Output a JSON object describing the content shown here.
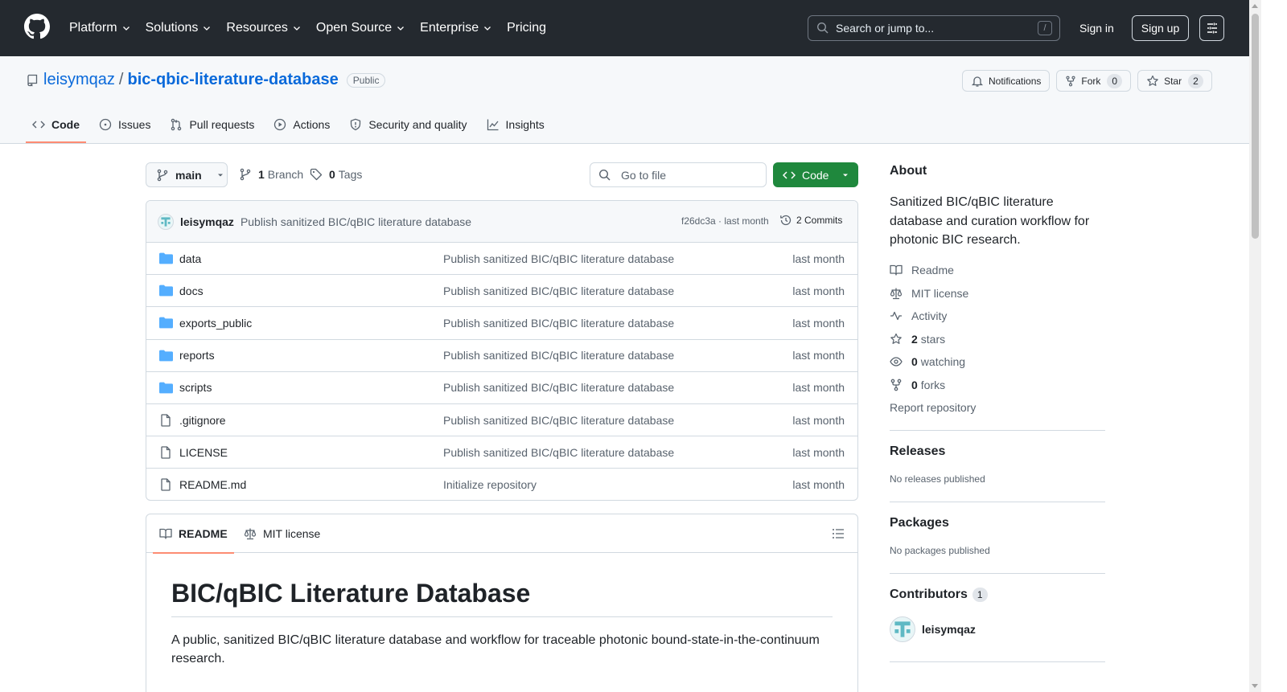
{
  "header": {
    "nav": [
      "Platform",
      "Solutions",
      "Resources",
      "Open Source",
      "Enterprise",
      "Pricing"
    ],
    "search_placeholder": "Search or jump to...",
    "search_shortcut": "/",
    "sign_in": "Sign in",
    "sign_up": "Sign up"
  },
  "repo": {
    "owner": "leisymqaz",
    "separator": "/",
    "name": "bic-qbic-literature-database",
    "visibility": "Public",
    "notifications": "Notifications",
    "fork_label": "Fork",
    "fork_count": "0",
    "star_label": "Star",
    "star_count": "2"
  },
  "tabs": [
    "Code",
    "Issues",
    "Pull requests",
    "Actions",
    "Security and quality",
    "Insights"
  ],
  "toolbar": {
    "branch": "main",
    "branch_count": "1",
    "branch_label": "Branch",
    "tag_count": "0",
    "tag_label": "Tags",
    "goto_placeholder": "Go to file",
    "code_button": "Code"
  },
  "latest_commit": {
    "author": "leisymqaz",
    "message": "Publish sanitized BIC/qBIC literature database",
    "sha_time": "f26dc3a · last month",
    "commits": "2 Commits"
  },
  "files": [
    {
      "type": "folder",
      "name": "data",
      "message": "Publish sanitized BIC/qBIC literature database",
      "date": "last month"
    },
    {
      "type": "folder",
      "name": "docs",
      "message": "Publish sanitized BIC/qBIC literature database",
      "date": "last month"
    },
    {
      "type": "folder",
      "name": "exports_public",
      "message": "Publish sanitized BIC/qBIC literature database",
      "date": "last month"
    },
    {
      "type": "folder",
      "name": "reports",
      "message": "Publish sanitized BIC/qBIC literature database",
      "date": "last month"
    },
    {
      "type": "folder",
      "name": "scripts",
      "message": "Publish sanitized BIC/qBIC literature database",
      "date": "last month"
    },
    {
      "type": "file",
      "name": ".gitignore",
      "message": "Publish sanitized BIC/qBIC literature database",
      "date": "last month"
    },
    {
      "type": "file",
      "name": "LICENSE",
      "message": "Publish sanitized BIC/qBIC literature database",
      "date": "last month"
    },
    {
      "type": "file",
      "name": "README.md",
      "message": "Initialize repository",
      "date": "last month"
    }
  ],
  "readme": {
    "tab_readme": "README",
    "tab_license": "MIT license",
    "title": "BIC/qBIC Literature Database",
    "intro": "A public, sanitized BIC/qBIC literature database and workflow for traceable photonic bound-state-in-the-continuum research."
  },
  "about": {
    "heading": "About",
    "description": "Sanitized BIC/qBIC literature database and curation workflow for photonic BIC research.",
    "readme": "Readme",
    "license": "MIT license",
    "activity": "Activity",
    "stars_count": "2",
    "stars_label": "stars",
    "watching_count": "0",
    "watching_label": "watching",
    "forks_count": "0",
    "forks_label": "forks",
    "report": "Report repository"
  },
  "releases": {
    "heading": "Releases",
    "text": "No releases published"
  },
  "packages": {
    "heading": "Packages",
    "text": "No packages published"
  },
  "contributors": {
    "heading": "Contributors",
    "count": "1",
    "name": "leisymqaz"
  },
  "colors": {
    "header_bg": "#24292f",
    "link": "#0969da",
    "code_green": "#1f883d",
    "tab_underline": "#fd8c73",
    "folder": "#54aeff"
  }
}
